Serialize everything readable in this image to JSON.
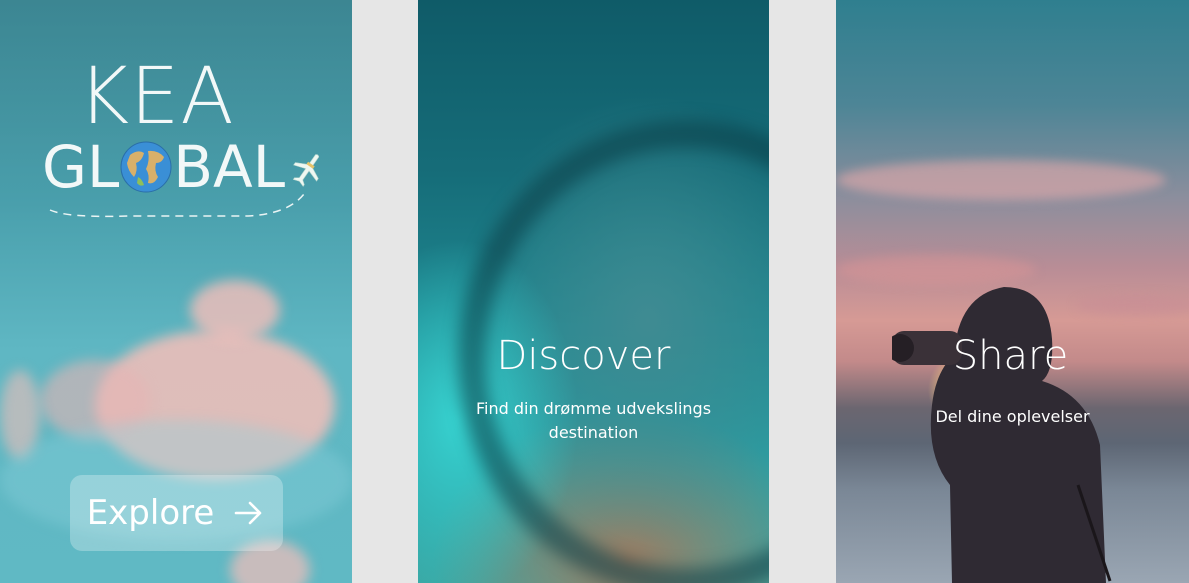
{
  "panels": [
    {
      "logo_line1": "KEA",
      "logo_line2_left": "GL",
      "logo_line2_right": "BAL",
      "button_label": "Explore",
      "icons": [
        "globe-icon",
        "airplane-icon",
        "arrow-right-icon"
      ]
    },
    {
      "title": "Discover",
      "subtitle": "Find din drømme udvekslings destination"
    },
    {
      "title": "Share",
      "subtitle": "Del dine oplevelser"
    }
  ],
  "colors": {
    "page_background": "#e6e6e6",
    "sky": "#4aa0ad",
    "ocean": "#1f8790",
    "text": "#ffffff"
  }
}
